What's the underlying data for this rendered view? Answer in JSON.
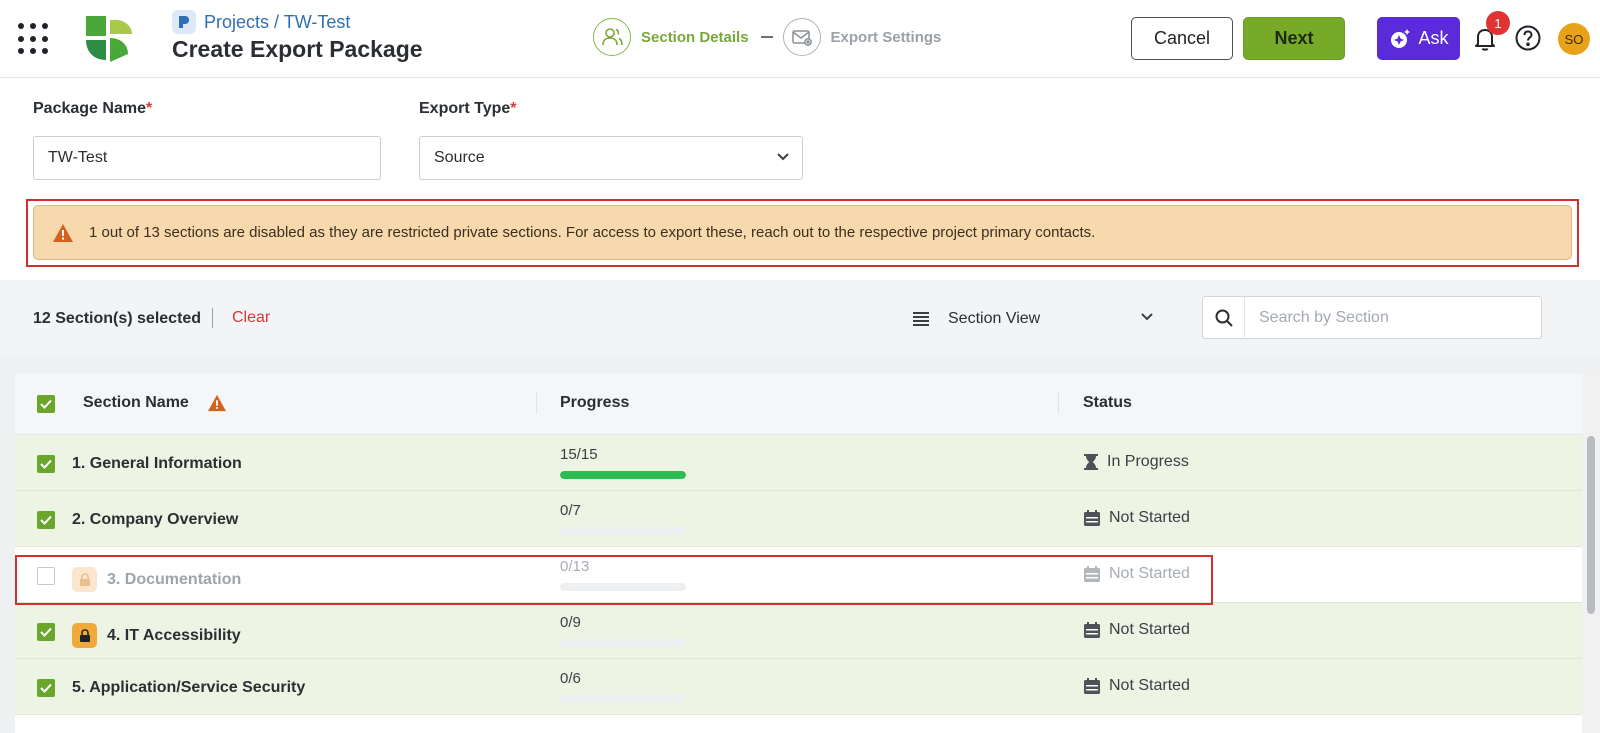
{
  "header": {
    "breadcrumb": "Projects / TW-Test",
    "title": "Create Export Package",
    "steps": [
      {
        "label": "Section Details",
        "state": "active"
      },
      {
        "label": "Export Settings",
        "state": "inactive"
      }
    ],
    "cancel_label": "Cancel",
    "next_label": "Next",
    "ask_label": "Ask",
    "notification_count": "1",
    "avatar_initials": "SO",
    "colors": {
      "accent_green": "#77aa29",
      "ask_purple": "#5b2bd9",
      "badge_red": "#e03434",
      "avatar_orange": "#e8a21a"
    }
  },
  "form": {
    "package_name_label": "Package Name",
    "package_name_value": "TW-Test",
    "export_type_label": "Export Type",
    "export_type_value": "Source",
    "required_marker": "*"
  },
  "alert": {
    "text": "1 out of 13 sections are disabled as they are restricted private sections. For access to export these, reach out to the respective project primary contacts.",
    "icon": "warning-icon"
  },
  "toolbar": {
    "selected_text": "12 Section(s) selected",
    "clear_label": "Clear",
    "view_label": "Section View",
    "search_placeholder": "Search by Section"
  },
  "table": {
    "columns": {
      "name": "Section Name",
      "progress": "Progress",
      "status": "Status"
    },
    "rows": [
      {
        "name": "1. General Information",
        "progress": "15/15",
        "progress_fraction": 1.0,
        "status": "In Progress",
        "status_icon": "hourglass-icon",
        "checked": true,
        "locked": false,
        "disabled": false
      },
      {
        "name": "2. Company Overview",
        "progress": "0/7",
        "progress_fraction": 0,
        "status": "Not Started",
        "status_icon": "calendar-icon",
        "checked": true,
        "locked": false,
        "disabled": false
      },
      {
        "name": "3. Documentation",
        "progress": "0/13",
        "progress_fraction": 0,
        "status": "Not Started",
        "status_icon": "calendar-icon",
        "checked": false,
        "locked": true,
        "disabled": true
      },
      {
        "name": "4. IT Accessibility",
        "progress": "0/9",
        "progress_fraction": 0,
        "status": "Not Started",
        "status_icon": "calendar-icon",
        "checked": true,
        "locked": true,
        "disabled": false
      },
      {
        "name": "5. Application/Service Security",
        "progress": "0/6",
        "progress_fraction": 0,
        "status": "Not Started",
        "status_icon": "calendar-icon",
        "checked": true,
        "locked": false,
        "disabled": false
      }
    ]
  }
}
